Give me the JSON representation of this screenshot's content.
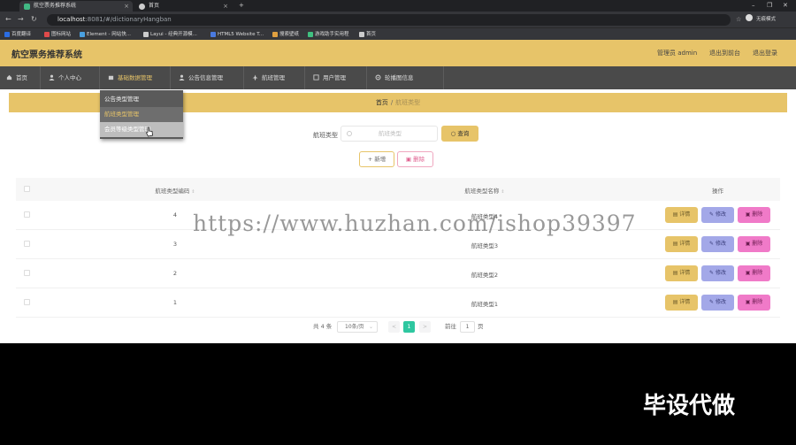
{
  "browser": {
    "tabs": [
      {
        "title": "航空票务推荐系统",
        "color": "#41b883"
      },
      {
        "title": "首页",
        "color": "#dddddd"
      }
    ],
    "new_tab": "+",
    "url_host": "localhost",
    "url_path": ":8081/#/dictionaryHangban",
    "profile": "无痕模式",
    "bookmarks": [
      "百度翻译",
      "图标网站",
      "Element - 网站快...",
      "Layui - 经典开源模...",
      "HTML5 Website T...",
      "搜索壁纸",
      "游戏助手实用程",
      "首页"
    ]
  },
  "header": {
    "title": "航空票务推荐系统",
    "user": "管理员 admin",
    "back_front": "退出到前台",
    "logout": "退出登录"
  },
  "menu": [
    {
      "label": "首页",
      "icon": "home-icon"
    },
    {
      "label": "个人中心",
      "icon": "user-icon"
    },
    {
      "label": "基础数据管理",
      "icon": "folder-icon",
      "active": true
    },
    {
      "label": "公告信息管理",
      "icon": "user-icon"
    },
    {
      "label": "航班管理",
      "icon": "plane-icon"
    },
    {
      "label": "用户管理",
      "icon": "users-icon"
    },
    {
      "label": "轮播图信息",
      "icon": "gear-icon"
    }
  ],
  "dropdown": [
    "公告类型管理",
    "航班类型管理",
    "会员等级类型管理"
  ],
  "breadcrumb": {
    "home": "首页",
    "sep": "/",
    "current": "航班类型"
  },
  "search": {
    "label": "航班类型",
    "placeholder": "航班类型",
    "button": "查询"
  },
  "actions": {
    "add": "新增",
    "delete": "删除"
  },
  "table": {
    "headers": {
      "code": "航班类型编码",
      "name": "航班类型名称",
      "ops": "操作"
    },
    "rows": [
      {
        "code": "4",
        "name": "航班类型4"
      },
      {
        "code": "3",
        "name": "航班类型3"
      },
      {
        "code": "2",
        "name": "航班类型2"
      },
      {
        "code": "1",
        "name": "航班类型1"
      }
    ],
    "btn_view": "详情",
    "btn_edit": "修改",
    "btn_delete": "删除"
  },
  "pagination": {
    "total": "共 4 条",
    "page_size": "10条/页",
    "current_page": "1",
    "goto": "前往",
    "goto_value": "1",
    "page_unit": "页",
    "prev": "<",
    "next": ">"
  },
  "watermark": "https://www.huzhan.com/ishop39397",
  "overlay_text": "毕设代做"
}
